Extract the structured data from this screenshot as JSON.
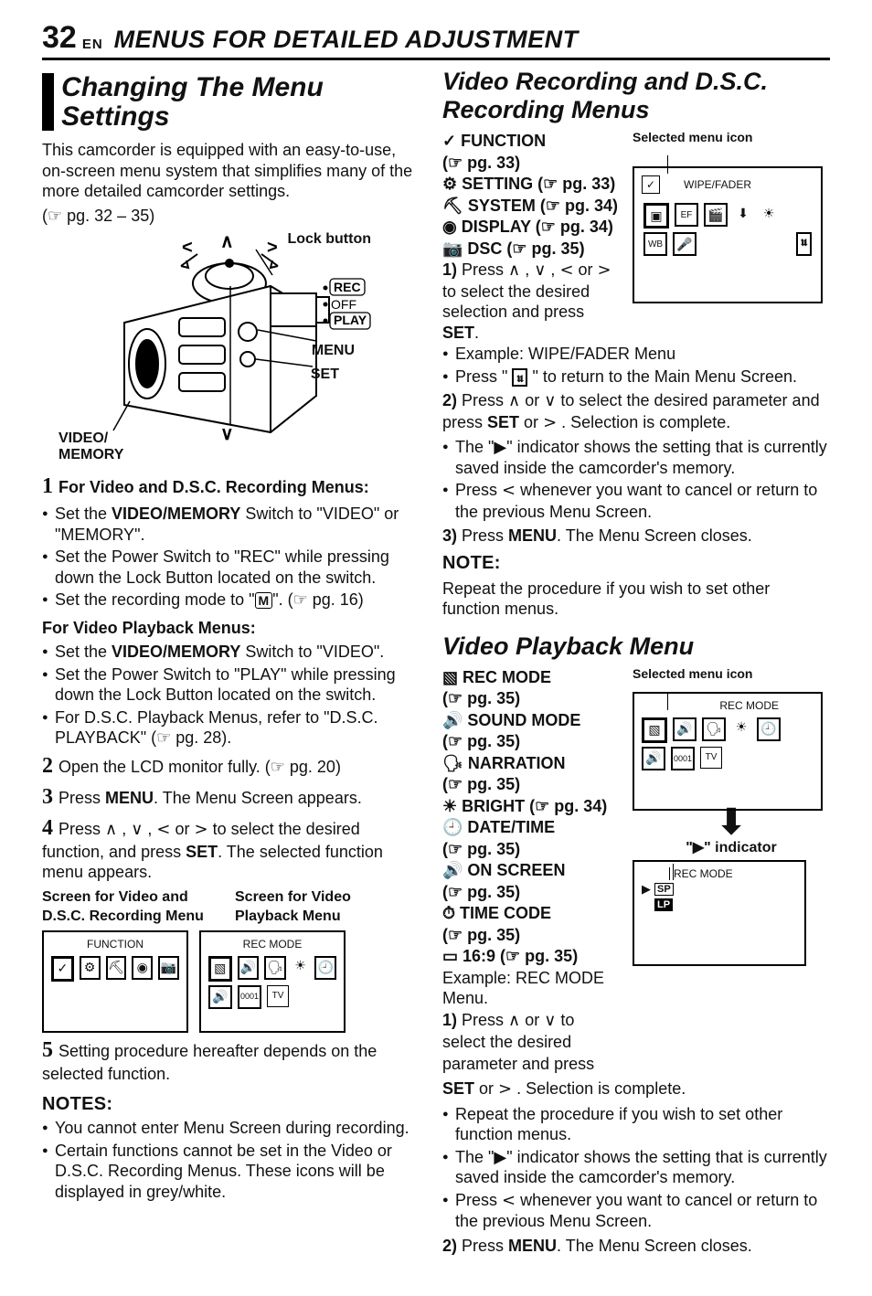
{
  "header": {
    "page_number": "32",
    "lang_code": "EN",
    "chapter_title": "MENUS FOR DETAILED ADJUSTMENT"
  },
  "left": {
    "h1": "Changing The Menu Settings",
    "intro_p1": "This camcorder is equipped with an easy-to-use, on-screen menu system that simplifies many of the more detailed camcorder settings.",
    "intro_pref": "(☞ pg. 32 – 35)",
    "fig": {
      "lock_button": "Lock button",
      "menu": "MENU",
      "set": "SET",
      "video_memory": "VIDEO/\nMEMORY",
      "rec": "REC",
      "off": "OFF",
      "play": "PLAY"
    },
    "step1_title": "For Video and D.S.C. Recording Menus:",
    "step1_b": [
      "Set the VIDEO/MEMORY Switch to \"VIDEO\" or \"MEMORY\".",
      "Set the Power Switch to \"REC\" while pressing down the Lock Button located on the switch.",
      "Set the recording mode to \"M\". (☞ pg. 16)"
    ],
    "playback_title": "For Video Playback Menus:",
    "playback_b": [
      "Set the VIDEO/MEMORY Switch to \"VIDEO\".",
      "Set the Power Switch to \"PLAY\" while pressing down the Lock Button located on the switch.",
      "For D.S.C. Playback Menus, refer to \"D.S.C. PLAYBACK\" (☞ pg. 28)."
    ],
    "step2": "Open the LCD monitor fully. (☞ pg. 20)",
    "step3": "Press MENU. The Menu Screen appears.",
    "step4": "Press ∧ , ∨ , < or >  to select the desired function, and press SET. The selected function menu appears.",
    "screens_label_left": "Screen for Video and D.S.C. Recording Menu",
    "screens_label_right": "Screen for Video Playback Menu",
    "lcd_left_title": "FUNCTION",
    "lcd_right_title": "REC MODE",
    "step5": "Setting procedure hereafter depends on the selected function.",
    "notes_h": "NOTES:",
    "notes": [
      "You cannot enter Menu Screen during recording.",
      "Certain functions cannot be set in the Video or D.S.C. Recording Menus. These icons will be displayed in grey/white."
    ]
  },
  "right": {
    "h2a": "Video Recording and D.S.C. Recording Menus",
    "sel_label": "Selected menu icon",
    "menu_list_a": {
      "function": "FUNCTION",
      "function_ref": "(☞ pg. 33)",
      "setting": "SETTING (☞ pg. 33)",
      "system": "SYSTEM (☞ pg. 34)",
      "display": "DISPLAY (☞ pg. 34)",
      "dsc": "DSC (☞ pg. 35)"
    },
    "a_step1": "1) Press ∧ , ∨ , < or > to select the desired selection and press SET.",
    "a_example": "Example: WIPE/FADER Menu",
    "a_bul1": "Press \" 𝖚 \" to return to the Main Menu Screen.",
    "a_step2": "2) Press ∧ or ∨ to select the desired parameter and press SET or > . Selection is complete.",
    "a_bul2": "The \"▶\" indicator shows the setting that is currently saved inside the camcorder's memory.",
    "a_bul3": "Press < whenever you want to cancel or return to the previous Menu Screen.",
    "a_step3": "3) Press MENU. The Menu Screen closes.",
    "note_h": "NOTE:",
    "note_p": "Repeat the procedure if you wish to set other function menus.",
    "lcd_a_title": "WIPE/FADER",
    "h2b": "Video Playback Menu",
    "menu_list_b": {
      "rec_mode": "REC MODE",
      "rec_mode_ref": "(☞ pg. 35)",
      "sound_mode": "SOUND MODE",
      "sound_mode_ref": "(☞ pg. 35)",
      "narration": "NARRATION",
      "narration_ref": "(☞ pg. 35)",
      "bright": "BRIGHT (☞ pg. 34)",
      "date_time": "DATE/TIME",
      "date_time_ref": "(☞ pg. 35)",
      "on_screen": "ON SCREEN",
      "on_screen_ref": "(☞ pg. 35)",
      "time_code": "TIME CODE",
      "time_code_ref": "(☞ pg. 35)",
      "sixteen9": "16:9 (☞ pg. 35)"
    },
    "b_example": "Example: REC MODE Menu.",
    "b_step1": "1) Press ∧ or ∨ to select the desired parameter and press SET or > . Selection is complete.",
    "b_bul1": "Repeat the procedure if you wish to set other function menus.",
    "b_bul2": "The \"▶\" indicator shows the setting that is currently saved inside the camcorder's memory.",
    "b_bul3": "Press < whenever you want to cancel or return to the previous Menu Screen.",
    "b_step2": "2) Press MENU. The Menu Screen closes.",
    "lcd_b_title": "REC MODE",
    "indicator_label": "\"▶\" indicator",
    "ind_lcd_title": "REC MODE",
    "sp": "SP",
    "lp": "LP"
  }
}
